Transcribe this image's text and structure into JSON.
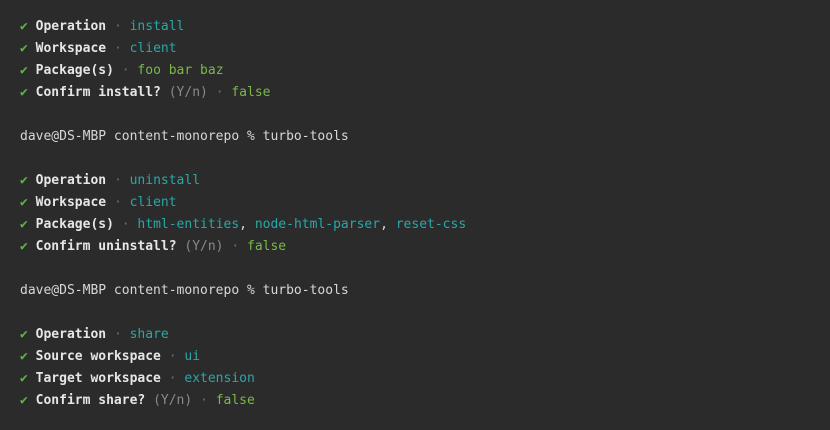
{
  "sections": [
    {
      "prompts": [
        {
          "label": "Operation",
          "values": [
            "install"
          ]
        },
        {
          "label": "Workspace",
          "values": [
            "client"
          ]
        },
        {
          "label": "Package(s)",
          "values": [
            "foo bar baz"
          ],
          "valueStyle": "green"
        },
        {
          "label": "Confirm install?",
          "hint": "(Y/n)",
          "values": [
            "false"
          ],
          "valueStyle": "green"
        }
      ]
    },
    {
      "command": "dave@DS-MBP content-monorepo % turbo-tools",
      "prompts": [
        {
          "label": "Operation",
          "values": [
            "uninstall"
          ]
        },
        {
          "label": "Workspace",
          "values": [
            "client"
          ]
        },
        {
          "label": "Package(s)",
          "values": [
            "html-entities",
            "node-html-parser",
            "reset-css"
          ]
        },
        {
          "label": "Confirm uninstall?",
          "hint": "(Y/n)",
          "values": [
            "false"
          ],
          "valueStyle": "green"
        }
      ]
    },
    {
      "command": "dave@DS-MBP content-monorepo % turbo-tools",
      "prompts": [
        {
          "label": "Operation",
          "values": [
            "share"
          ]
        },
        {
          "label": "Source workspace",
          "values": [
            "ui"
          ]
        },
        {
          "label": "Target workspace",
          "values": [
            "extension"
          ]
        },
        {
          "label": "Confirm share?",
          "hint": "(Y/n)",
          "values": [
            "false"
          ],
          "valueStyle": "green"
        }
      ]
    }
  ],
  "glyphs": {
    "check": "✔",
    "separator": "·",
    "list_separator": ", "
  },
  "colors": {
    "background": "#2b2b2b",
    "check": "#5fb34a",
    "cyan_value": "#2aa7a7",
    "green_value": "#79b84b",
    "hint": "#8a8a8a",
    "separator": "#6e6e6e"
  }
}
